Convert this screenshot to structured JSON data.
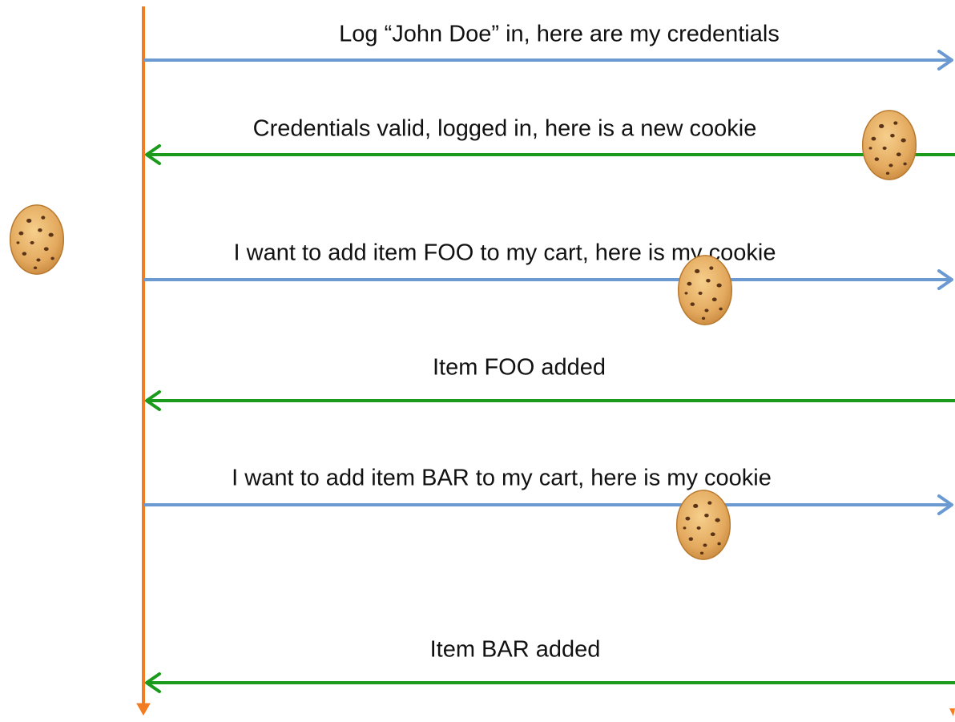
{
  "diagram": {
    "type": "sequence",
    "colors": {
      "lifeline": "#f47c20",
      "request": "#6a9ad1",
      "response": "#1b9a1b",
      "text": "#111111",
      "cookie_dough": "#e8b26a",
      "cookie_edge": "#b8792f",
      "cookie_chip": "#5b3418"
    },
    "client_cookie": {
      "icon": "cookie-icon"
    },
    "messages": [
      {
        "label": "Log “John Doe” in, here are my credentials",
        "direction": "to-server",
        "kind": "request",
        "cookie": false
      },
      {
        "label": "Credentials valid, logged in, here is a new cookie",
        "direction": "to-client",
        "kind": "response",
        "cookie": true
      },
      {
        "label": "I want to add item FOO to my cart, here is my cookie",
        "direction": "to-server",
        "kind": "request",
        "cookie": true
      },
      {
        "label": "Item FOO added",
        "direction": "to-client",
        "kind": "response",
        "cookie": false
      },
      {
        "label": "I want to add item BAR to my cart, here is my cookie",
        "direction": "to-server",
        "kind": "request",
        "cookie": true
      },
      {
        "label": "Item BAR added",
        "direction": "to-client",
        "kind": "response",
        "cookie": false
      }
    ]
  }
}
